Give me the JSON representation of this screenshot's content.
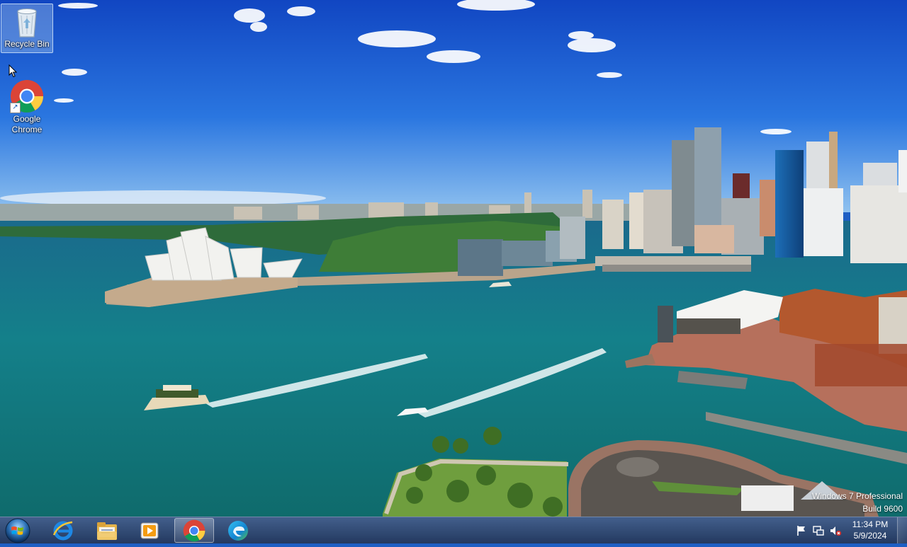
{
  "desktop": {
    "icons": [
      {
        "label": "Recycle Bin",
        "icon": "recycle-bin-icon",
        "selected": true
      },
      {
        "label": "Google\nChrome",
        "icon": "chrome-icon",
        "selected": false
      }
    ],
    "watermark": {
      "line1": "Windows 7 Professional",
      "line2": "Build 9600"
    }
  },
  "taskbar": {
    "start": "start-orb-icon",
    "pinned": [
      {
        "name": "Internet Explorer",
        "icon": "internet-explorer-icon"
      },
      {
        "name": "Windows Explorer",
        "icon": "file-explorer-icon"
      },
      {
        "name": "Windows Media Player",
        "icon": "media-player-icon"
      },
      {
        "name": "Google Chrome",
        "icon": "chrome-icon",
        "active": true
      },
      {
        "name": "Microsoft Edge",
        "icon": "edge-icon"
      }
    ],
    "tray": {
      "icons": [
        "action-center-flag-icon",
        "network-icon",
        "volume-muted-icon"
      ],
      "time": "11:34 PM",
      "date": "5/9/2024"
    }
  },
  "colors": {
    "sky_top": "#1552c8",
    "sky_horizon": "#5ea0e6",
    "water": "#137a86",
    "taskbar": "#2f4670"
  }
}
